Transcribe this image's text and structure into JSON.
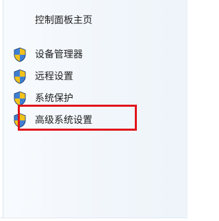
{
  "sidebar": {
    "home_label": "控制面板主页",
    "items": [
      {
        "label": "设备管理器",
        "icon": "uac-shield-icon"
      },
      {
        "label": "远程设置",
        "icon": "uac-shield-icon"
      },
      {
        "label": "系统保护",
        "icon": "uac-shield-icon"
      },
      {
        "label": "高级系统设置",
        "icon": "uac-shield-icon"
      }
    ]
  },
  "annotation": {
    "highlight_color": "#e0131a",
    "highlighted_item": "高级系统设置"
  }
}
